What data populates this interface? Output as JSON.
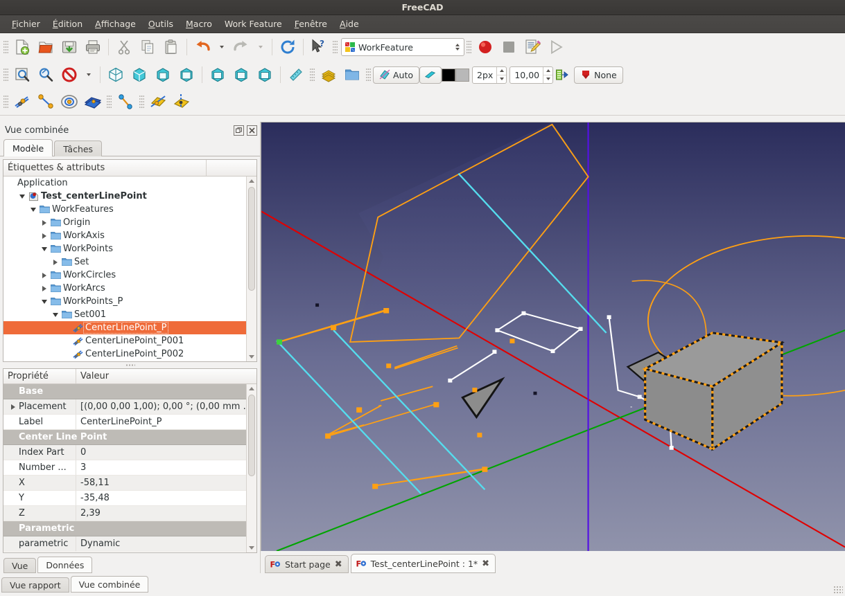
{
  "window": {
    "title": "FreeCAD"
  },
  "menubar": {
    "items": [
      {
        "label": "Fichier",
        "mnemonic": "F"
      },
      {
        "label": "Édition",
        "mnemonic": "É"
      },
      {
        "label": "Affichage",
        "mnemonic": "A"
      },
      {
        "label": "Outils",
        "mnemonic": "O"
      },
      {
        "label": "Macro",
        "mnemonic": "M"
      },
      {
        "label": "Work Feature",
        "mnemonic": ""
      },
      {
        "label": "Fenêtre",
        "mnemonic": "F"
      },
      {
        "label": "Aide",
        "mnemonic": "A"
      }
    ]
  },
  "toolbar": {
    "workbench_value": "WorkFeature",
    "auto_label": "Auto",
    "line_width_value": "2px",
    "size_value": "10,00",
    "none_label": "None",
    "icons_row1": [
      "new-document-icon",
      "open-folder-icon",
      "save-icon",
      "print-icon",
      "cut-icon",
      "copy-icon",
      "paste-icon",
      "undo-icon",
      "redo-icon",
      "refresh-icon",
      "whats-this-icon"
    ],
    "icons_row2": [
      "fit-all-icon",
      "fit-selection-icon",
      "draw-style-icon",
      "isometric-view-icon",
      "front-view-icon",
      "top-view-icon",
      "right-view-icon",
      "rear-view-icon",
      "bottom-view-icon",
      "left-view-icon",
      "measure-icon",
      "workbench-part-icon",
      "folder-icon"
    ],
    "icons_row3": [
      "line-point-icon",
      "line-two-points-icon",
      "circle-center-icon",
      "plane-icon",
      "axis-point-icon",
      "plane-cut-icon",
      "plane-axis-icon"
    ],
    "macro_record_icon": "record-macro-icon",
    "macro_stop_icon": "stop-macro-icon",
    "macro_edit_icon": "edit-macro-icon",
    "macro_exec_icon": "execute-macro-icon"
  },
  "combined_view": {
    "title": "Vue combinée",
    "tabs": [
      {
        "label": "Modèle",
        "active": true
      },
      {
        "label": "Tâches",
        "active": false
      }
    ],
    "tree": {
      "column_header": "Étiquettes & attributs",
      "nodes": [
        {
          "label": "Application",
          "depth": 0,
          "expander": "none",
          "icon": "none",
          "bold": false,
          "selected": false
        },
        {
          "label": "Test_centerLinePoint",
          "depth": 1,
          "expander": "down",
          "icon": "document-icon",
          "bold": true,
          "selected": false
        },
        {
          "label": "WorkFeatures",
          "depth": 2,
          "expander": "down",
          "icon": "folder-icon",
          "bold": false,
          "selected": false
        },
        {
          "label": "Origin",
          "depth": 3,
          "expander": "right",
          "icon": "folder-icon",
          "bold": false,
          "selected": false
        },
        {
          "label": "WorkAxis",
          "depth": 3,
          "expander": "right",
          "icon": "folder-icon",
          "bold": false,
          "selected": false
        },
        {
          "label": "WorkPoints",
          "depth": 3,
          "expander": "down",
          "icon": "folder-icon",
          "bold": false,
          "selected": false
        },
        {
          "label": "Set",
          "depth": 4,
          "expander": "right",
          "icon": "folder-icon",
          "bold": false,
          "selected": false
        },
        {
          "label": "WorkCircles",
          "depth": 3,
          "expander": "right",
          "icon": "folder-icon",
          "bold": false,
          "selected": false
        },
        {
          "label": "WorkArcs",
          "depth": 3,
          "expander": "right",
          "icon": "folder-icon",
          "bold": false,
          "selected": false
        },
        {
          "label": "WorkPoints_P",
          "depth": 3,
          "expander": "down",
          "icon": "folder-icon",
          "bold": false,
          "selected": false
        },
        {
          "label": "Set001",
          "depth": 4,
          "expander": "down",
          "icon": "folder-icon",
          "bold": false,
          "selected": false
        },
        {
          "label": "CenterLinePoint_P",
          "depth": 5,
          "expander": "none",
          "icon": "workpoint-icon",
          "bold": false,
          "selected": true
        },
        {
          "label": "CenterLinePoint_P001",
          "depth": 5,
          "expander": "none",
          "icon": "workpoint-icon",
          "bold": false,
          "selected": false
        },
        {
          "label": "CenterLinePoint_P002",
          "depth": 5,
          "expander": "none",
          "icon": "workpoint-icon",
          "bold": false,
          "selected": false
        }
      ]
    },
    "properties": {
      "headers": [
        "Propriété",
        "Valeur"
      ],
      "rows": [
        {
          "kind": "group",
          "key": "Base"
        },
        {
          "kind": "item",
          "key": "Placement",
          "value": "[(0,00 0,00 1,00); 0,00 °; (0,00 mm  …",
          "expandable": true
        },
        {
          "kind": "item",
          "key": "Label",
          "value": "CenterLinePoint_P",
          "expandable": false
        },
        {
          "kind": "group",
          "key": "Center Line Point"
        },
        {
          "kind": "item",
          "key": "Index Part",
          "value": "0",
          "expandable": false
        },
        {
          "kind": "item",
          "key": "Number ...",
          "value": "3",
          "expandable": false
        },
        {
          "kind": "item",
          "key": "X",
          "value": "-58,11",
          "expandable": false
        },
        {
          "kind": "item",
          "key": "Y",
          "value": "-35,48",
          "expandable": false
        },
        {
          "kind": "item",
          "key": "Z",
          "value": "2,39",
          "expandable": false
        },
        {
          "kind": "group",
          "key": "Parametric"
        },
        {
          "kind": "item",
          "key": "parametric",
          "value": "Dynamic",
          "expandable": false
        }
      ]
    },
    "prop_tabs": [
      {
        "label": "Vue",
        "active": false
      },
      {
        "label": "Données",
        "active": true
      }
    ],
    "dock_tabs": [
      {
        "label": "Vue rapport",
        "active": false
      },
      {
        "label": "Vue combinée",
        "active": true
      }
    ]
  },
  "document_tabs": [
    {
      "label": "Start page",
      "active": false,
      "icon": "freecad-icon"
    },
    {
      "label": "Test_centerLinePoint : 1*",
      "active": true,
      "icon": "freecad-icon"
    }
  ],
  "viewport": {
    "background_top": "#2b2d5c",
    "background_bottom": "#9093ab",
    "axis_x_color": "#e00000",
    "axis_y_color": "#00a000",
    "axis_z_color": "#5b10e0",
    "geometry_color": "#ffa013",
    "construction_color": "#55ddee",
    "white_color": "#ffffff",
    "solid_face_color": "#8c8c8c",
    "solid_edge_color": "#1b1b1b"
  }
}
